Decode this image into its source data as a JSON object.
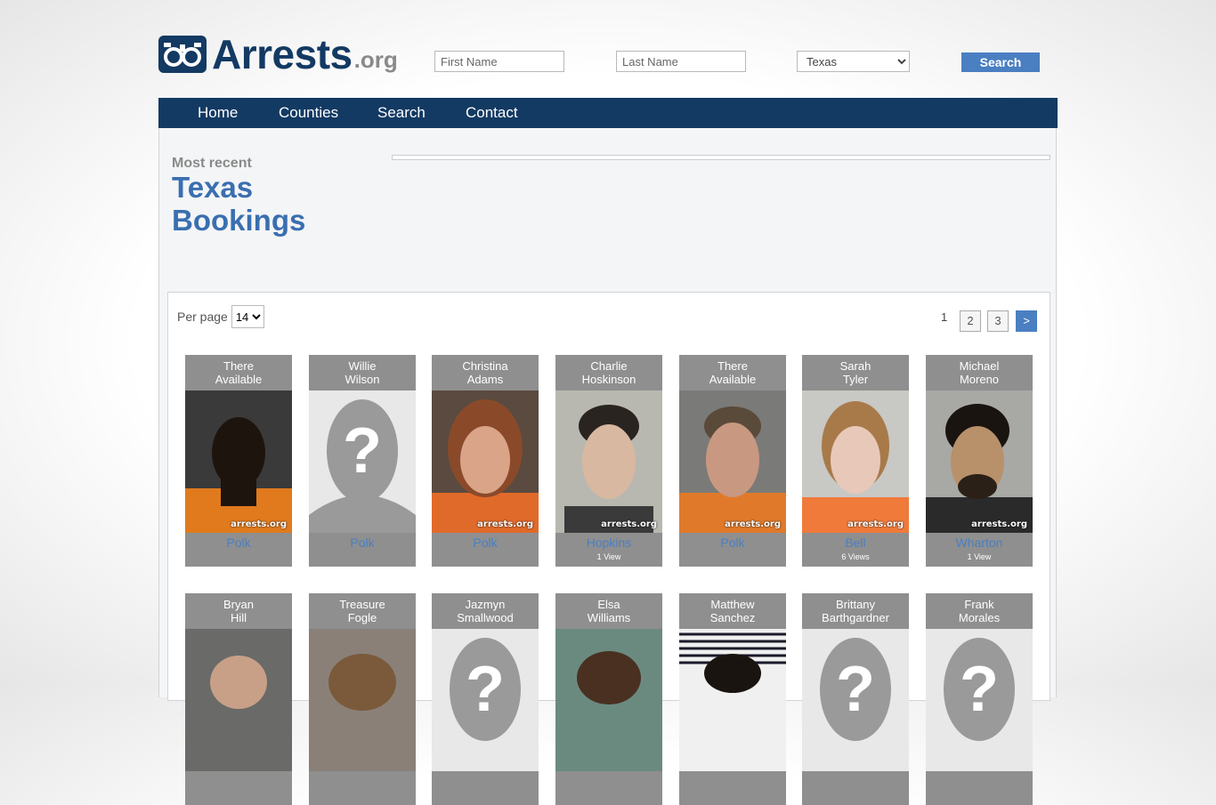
{
  "logo": {
    "word": "Arrests",
    "ext": ".org"
  },
  "search": {
    "first_placeholder": "First Name",
    "last_placeholder": "Last Name",
    "state": "Texas",
    "button": "Search"
  },
  "nav": [
    "Home",
    "Counties",
    "Search",
    "Contact"
  ],
  "heading": {
    "small": "Most recent",
    "line1": "Texas",
    "line2": "Bookings"
  },
  "perpage": {
    "label": "Per page",
    "value": "14"
  },
  "pagination": {
    "current": "1",
    "pages": [
      "2",
      "3"
    ],
    "next": ">"
  },
  "watermark": "arrests.org",
  "row1": [
    {
      "first": "There",
      "last": "Available",
      "county": "Polk",
      "views": "",
      "photo": "person-dark"
    },
    {
      "first": "Willie",
      "last": "Wilson",
      "county": "Polk",
      "views": "",
      "photo": "placeholder"
    },
    {
      "first": "Christina",
      "last": "Adams",
      "county": "Polk",
      "views": "",
      "photo": "person-red"
    },
    {
      "first": "Charlie",
      "last": "Hoskinson",
      "county": "Hopkins",
      "views": "1 View",
      "photo": "person-light"
    },
    {
      "first": "There",
      "last": "Available",
      "county": "Polk",
      "views": "",
      "photo": "person-orange"
    },
    {
      "first": "Sarah",
      "last": "Tyler",
      "county": "Bell",
      "views": "6 Views",
      "photo": "person-blonde"
    },
    {
      "first": "Michael",
      "last": "Moreno",
      "county": "Wharton",
      "views": "1 View",
      "photo": "person-dark2"
    }
  ],
  "row2": [
    {
      "first": "Bryan",
      "last": "Hill"
    },
    {
      "first": "Treasure",
      "last": "Fogle"
    },
    {
      "first": "Jazmyn",
      "last": "Smallwood"
    },
    {
      "first": "Elsa",
      "last": "Williams"
    },
    {
      "first": "Matthew",
      "last": "Sanchez"
    },
    {
      "first": "Brittany",
      "last": "Barthgardner"
    },
    {
      "first": "Frank",
      "last": "Morales"
    }
  ]
}
